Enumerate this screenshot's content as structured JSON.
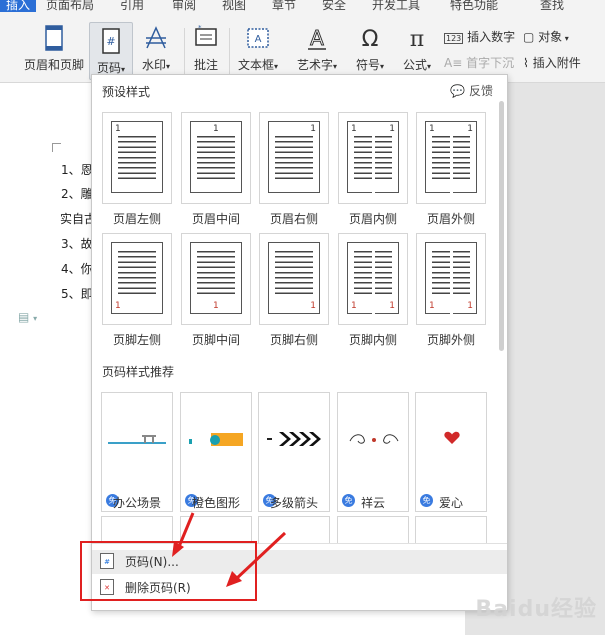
{
  "menubar": [
    "插入",
    "页面布局",
    "引用",
    "审阅",
    "视图",
    "章节",
    "安全",
    "开发工具",
    "特色功能",
    "查找"
  ],
  "ribbon": {
    "header_footer": "页眉和页脚",
    "page_number": "页码",
    "watermark": "水印",
    "comment": "批注",
    "textbox": "文本框",
    "wordart": "艺术字",
    "symbol": "符号",
    "formula": "公式",
    "insert_number": "插入数字",
    "object": "对象",
    "drop_cap": "首字下沉",
    "attachment": "插入附件"
  },
  "document": {
    "lines": [
      "1、恩",
      "2、雕",
      "实自古",
      "3、故",
      "4、你",
      "5、即"
    ]
  },
  "panel": {
    "preset_title": "预设样式",
    "feedback": "反馈",
    "header_styles": [
      "页眉左侧",
      "页眉中间",
      "页眉右侧",
      "页眉内侧",
      "页眉外侧"
    ],
    "footer_styles": [
      "页脚左侧",
      "页脚中间",
      "页脚右侧",
      "页脚内侧",
      "页脚外侧"
    ],
    "recommend_title": "页码样式推荐",
    "recommended": [
      "办公场景",
      "橙色图形",
      "多级箭头",
      "祥云",
      "爱心"
    ],
    "badge": "免",
    "menu": {
      "page_number_dialog": "页码(N)...",
      "remove_page_number": "删除页码(R)"
    }
  },
  "watermark_text": "Baidu经验"
}
